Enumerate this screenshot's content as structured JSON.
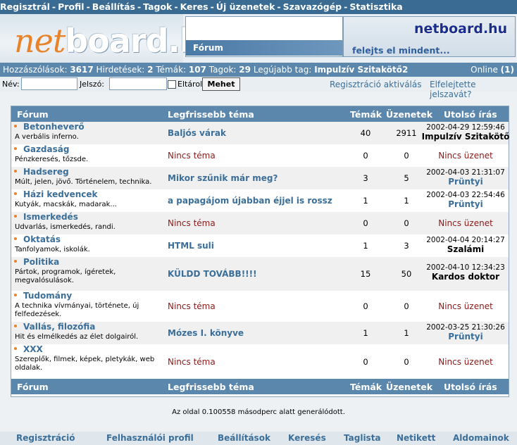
{
  "topnav": [
    "Regisztrál",
    "Profil",
    "Beállítás",
    "Tagok",
    "Keres",
    "Új üzenetek",
    "Szavazógép",
    "Statisztika"
  ],
  "header": {
    "logo_net": "net",
    "logo_board": "board.hu",
    "forum_label": "Fórum",
    "brand_name": "netboard.hu",
    "slogan": "felejts el mindent..."
  },
  "stats": {
    "posts_label": "Hozzászólások:",
    "posts": "3617",
    "ads_label": "Hirdetések:",
    "ads": "2",
    "topics_label": "Témák:",
    "topics": "107",
    "members_label": "Tagok:",
    "members": "29",
    "newest_label": "Legújabb tag:",
    "newest": "Impulzív Szitakötő2",
    "online_label": "Online",
    "online": "(1)"
  },
  "login": {
    "name_label": "Név:",
    "password_label": "Jelszó:",
    "remember_label": "Eltárol",
    "submit": "Mehet",
    "activate_link": "Regisztráció aktiválás",
    "forgot_link": "Elfelejtette jelszavát?"
  },
  "table": {
    "headers": {
      "forum": "Fórum",
      "latest": "Legfrissebb téma",
      "topics": "Témák",
      "messages": "Üzenetek",
      "last": "Utolsó írás"
    },
    "rows": [
      {
        "name": "Betonheverő",
        "desc": "A verbális inferno.",
        "topic": "Baljós várak",
        "topics": "40",
        "messages": "2911",
        "date": "2002-04-29 12:59:46",
        "author": "Impulzív Szitakötő"
      },
      {
        "name": "Gazdaság",
        "desc": "Pénzkeresés, tőzsde.",
        "topic": "Nincs téma",
        "topics": "0",
        "messages": "0",
        "none": "Nincs üzenet"
      },
      {
        "name": "Hadsereg",
        "desc": "Múlt, jelen, jövő. Történelem, technika.",
        "topic": "Mikor szűnik már meg?",
        "topics": "3",
        "messages": "5",
        "date": "2002-04-03 21:31:07",
        "author": "Prüntyi"
      },
      {
        "name": "Házi kedvencek",
        "desc": "Kutyák, macskák, madarak...",
        "topic": "a papagájom újabban éjjel is rossz",
        "topics": "1",
        "messages": "1",
        "date": "2002-04-03 22:54:46",
        "author": "Prüntyi"
      },
      {
        "name": "Ismerkedés",
        "desc": "Udvarlás, ismerkedés, randi.",
        "topic": "Nincs téma",
        "topics": "0",
        "messages": "0",
        "none": "Nincs üzenet"
      },
      {
        "name": "Oktatás",
        "desc": "Tanfolyamok, iskolák.",
        "topic": "HTML suli",
        "topics": "1",
        "messages": "3",
        "date": "2002-04-04 20:14:27",
        "author": "Szalámi"
      },
      {
        "name": "Politika",
        "desc": "Pártok, programok, ígéretek, megvalósulások.",
        "topic": "KÜLDD TOVÁBB!!!!",
        "topics": "15",
        "messages": "50",
        "date": "2002-04-10 12:34:23",
        "author": "Kardos doktor"
      },
      {
        "name": "Tudomány",
        "desc": "A technika vívmányai, története, új felfedezések.",
        "topic": "Nincs téma",
        "topics": "0",
        "messages": "0",
        "none": "Nincs üzenet"
      },
      {
        "name": "Vallás, filozófia",
        "desc": "Hit és elmélkedés az élet dolgairól.",
        "topic": "Mózes I. könyve",
        "topics": "1",
        "messages": "1",
        "date": "2002-03-25 21:30:26",
        "author": "Prüntyi"
      },
      {
        "name": "XXX",
        "desc": "Szereplők, filmek, képek, pletykák, web oldalak.",
        "topic": "Nincs téma",
        "topics": "0",
        "messages": "0",
        "none": "Nincs üzenet"
      }
    ]
  },
  "footer_note": "Az oldal 0.100558 másodperc alatt generálódott.",
  "bottomnav": [
    "Regisztráció",
    "Felhasználói profil",
    "Beállítások",
    "Keresés",
    "Taglista",
    "Netikett",
    "Aldomainok"
  ]
}
